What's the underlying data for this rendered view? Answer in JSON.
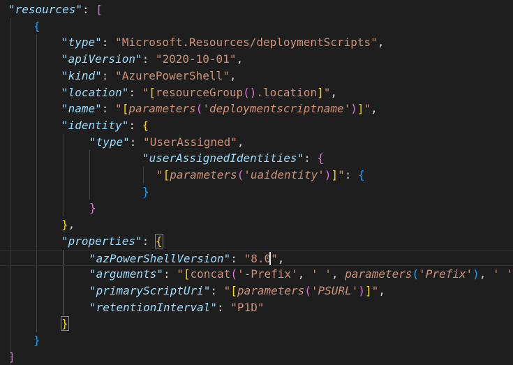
{
  "editor": {
    "language": "json",
    "theme": "dark",
    "current_line": 16,
    "lines": [
      [
        {
          "t": "\"resources\"",
          "c": "key"
        },
        {
          "t": ": ",
          "c": "punc"
        },
        {
          "t": "[",
          "c": "p2"
        }
      ],
      [
        {
          "t": "{",
          "c": "p3"
        }
      ],
      [
        {
          "t": "\"type\"",
          "c": "key"
        },
        {
          "t": ": ",
          "c": "punc"
        },
        {
          "t": "\"Microsoft.Resources/deploymentScripts\"",
          "c": "str"
        },
        {
          "t": ",",
          "c": "punc"
        }
      ],
      [
        {
          "t": "\"apiVersion\"",
          "c": "key"
        },
        {
          "t": ": ",
          "c": "punc"
        },
        {
          "t": "\"2020-10-01\"",
          "c": "str"
        },
        {
          "t": ",",
          "c": "punc"
        }
      ],
      [
        {
          "t": "\"kind\"",
          "c": "key"
        },
        {
          "t": ": ",
          "c": "punc"
        },
        {
          "t": "\"AzurePowerShell\"",
          "c": "str"
        },
        {
          "t": ",",
          "c": "punc"
        }
      ],
      [
        {
          "t": "\"location\"",
          "c": "key"
        },
        {
          "t": ": ",
          "c": "punc"
        },
        {
          "t": "\"",
          "c": "str"
        },
        {
          "t": "[",
          "c": "p1"
        },
        {
          "t": "resourceGroup",
          "c": "str"
        },
        {
          "t": "()",
          "c": "p2"
        },
        {
          "t": ".location",
          "c": "str"
        },
        {
          "t": "]",
          "c": "p1"
        },
        {
          "t": "\"",
          "c": "str"
        },
        {
          "t": ",",
          "c": "punc"
        }
      ],
      [
        {
          "t": "\"name\"",
          "c": "key"
        },
        {
          "t": ": ",
          "c": "punc"
        },
        {
          "t": "\"",
          "c": "str"
        },
        {
          "t": "[",
          "c": "p1"
        },
        {
          "t": "parameters",
          "c": "str ital"
        },
        {
          "t": "(",
          "c": "p2"
        },
        {
          "t": "'deploymentscriptname'",
          "c": "str ital"
        },
        {
          "t": ")",
          "c": "p2"
        },
        {
          "t": "]",
          "c": "p1"
        },
        {
          "t": "\"",
          "c": "str"
        },
        {
          "t": ",",
          "c": "punc"
        }
      ],
      [
        {
          "t": "\"identity\"",
          "c": "key"
        },
        {
          "t": ": ",
          "c": "punc"
        },
        {
          "t": "{",
          "c": "p1"
        }
      ],
      [
        {
          "t": "\"type\"",
          "c": "key"
        },
        {
          "t": ": ",
          "c": "punc"
        },
        {
          "t": "\"UserAssigned\"",
          "c": "str"
        },
        {
          "t": ",",
          "c": "punc"
        }
      ],
      [
        {
          "t": "\"userAssignedIdentities\"",
          "c": "key"
        },
        {
          "t": ": ",
          "c": "punc"
        },
        {
          "t": "{",
          "c": "p2"
        }
      ],
      [
        {
          "t": "\"",
          "c": "str"
        },
        {
          "t": "[",
          "c": "p1"
        },
        {
          "t": "parameters",
          "c": "str ital"
        },
        {
          "t": "(",
          "c": "p2"
        },
        {
          "t": "'uaidentity'",
          "c": "str ital"
        },
        {
          "t": ")",
          "c": "p2"
        },
        {
          "t": "]",
          "c": "p1"
        },
        {
          "t": "\"",
          "c": "str"
        },
        {
          "t": ": ",
          "c": "punc"
        },
        {
          "t": "{",
          "c": "p3"
        }
      ],
      [
        {
          "t": "}",
          "c": "p3"
        }
      ],
      [
        {
          "t": "}",
          "c": "p2"
        }
      ],
      [
        {
          "t": "}",
          "c": "p1"
        },
        {
          "t": ",",
          "c": "punc"
        }
      ],
      [
        {
          "t": "\"properties\"",
          "c": "key"
        },
        {
          "t": ": ",
          "c": "punc"
        },
        {
          "t": "{",
          "c": "p1 bracket-match"
        }
      ],
      [
        {
          "t": "\"azPowerShellVersion\"",
          "c": "key"
        },
        {
          "t": ": ",
          "c": "punc"
        },
        {
          "t": "\"8.0\"",
          "c": "str"
        },
        {
          "t": ",",
          "c": "punc"
        }
      ],
      [
        {
          "t": "\"arguments\"",
          "c": "key"
        },
        {
          "t": ": ",
          "c": "punc"
        },
        {
          "t": "\"",
          "c": "str"
        },
        {
          "t": "[",
          "c": "p1"
        },
        {
          "t": "concat",
          "c": "str"
        },
        {
          "t": "(",
          "c": "p2"
        },
        {
          "t": "'-Prefix'",
          "c": "str"
        },
        {
          "t": ", ",
          "c": "punc"
        },
        {
          "t": "' '",
          "c": "str"
        },
        {
          "t": ", ",
          "c": "punc"
        },
        {
          "t": "parameters",
          "c": "str ital"
        },
        {
          "t": "(",
          "c": "p3"
        },
        {
          "t": "'Prefix'",
          "c": "str ital"
        },
        {
          "t": ")",
          "c": "p3"
        },
        {
          "t": ", ",
          "c": "punc"
        },
        {
          "t": "' '",
          "c": "str"
        }
      ],
      [
        {
          "t": "\"primaryScriptUri\"",
          "c": "key"
        },
        {
          "t": ": ",
          "c": "punc"
        },
        {
          "t": "\"",
          "c": "str"
        },
        {
          "t": "[",
          "c": "p1"
        },
        {
          "t": "parameters",
          "c": "str ital"
        },
        {
          "t": "(",
          "c": "p2"
        },
        {
          "t": "'PSURL'",
          "c": "str ital"
        },
        {
          "t": ")",
          "c": "p2"
        },
        {
          "t": "]",
          "c": "p1"
        },
        {
          "t": "\"",
          "c": "str"
        },
        {
          "t": ",",
          "c": "punc"
        }
      ],
      [
        {
          "t": "\"retentionInterval\"",
          "c": "key"
        },
        {
          "t": ": ",
          "c": "punc"
        },
        {
          "t": "\"P1D\"",
          "c": "str"
        }
      ],
      [
        {
          "t": "}",
          "c": "p1 bracket-match"
        }
      ],
      [
        {
          "t": "}",
          "c": "p3"
        }
      ],
      [
        {
          "t": "]",
          "c": "p2"
        }
      ]
    ]
  }
}
